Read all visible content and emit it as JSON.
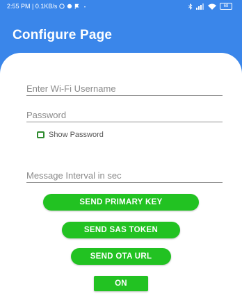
{
  "status_bar": {
    "time_text": "2:55 PM | 0.1KB/s",
    "battery": "68"
  },
  "header": {
    "title": "Configure Page"
  },
  "form": {
    "wifi_username": {
      "placeholder": "Enter Wi-Fi Username",
      "value": ""
    },
    "password": {
      "placeholder": "Password",
      "value": ""
    },
    "show_password_label": "Show Password",
    "message_interval": {
      "placeholder": "Message Interval in sec",
      "value": ""
    }
  },
  "buttons": {
    "send_primary_key": "SEND PRIMARY KEY",
    "send_sas_token": "SEND SAS TOKEN",
    "send_ota_url": "SEND OTA URL",
    "toggle": "ON"
  },
  "colors": {
    "app_bar": "#3a86ea",
    "button": "#22c222",
    "checkbox": "#2e8b2e"
  }
}
